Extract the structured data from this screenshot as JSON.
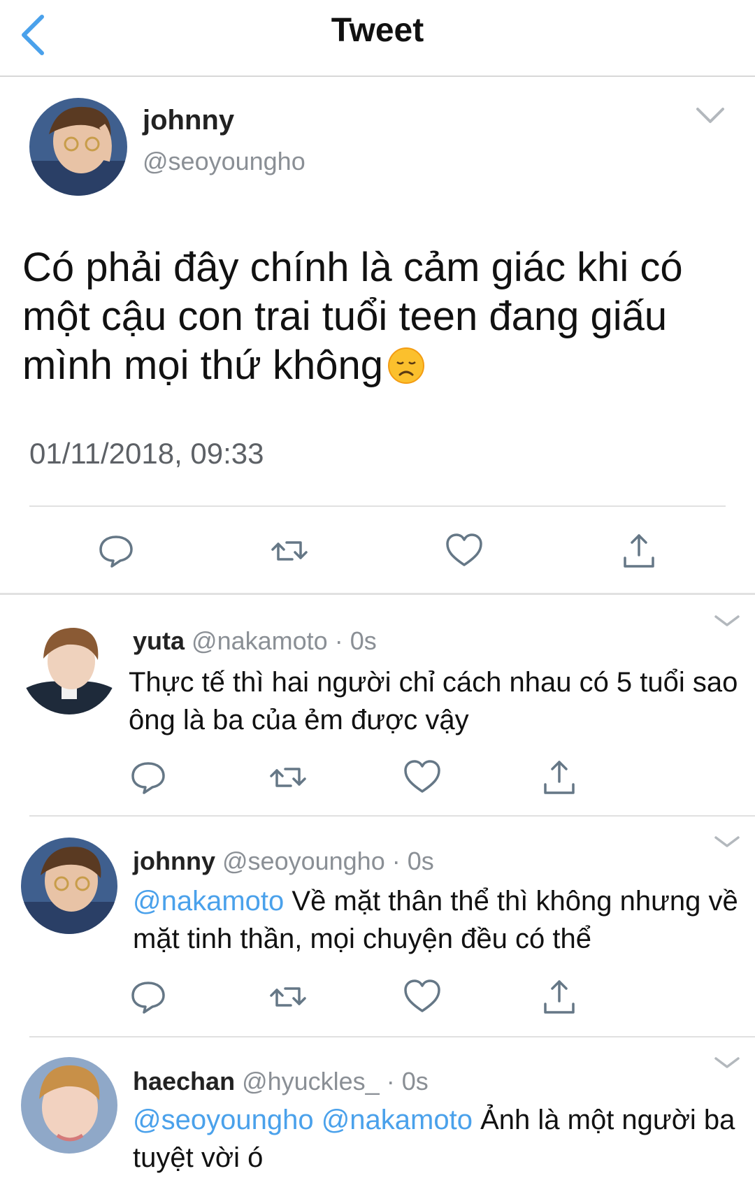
{
  "header": {
    "title": "Tweet"
  },
  "tweet": {
    "author": {
      "name": "johnny",
      "handle": "@seoyoungho"
    },
    "text": "Có phải đây chính là cảm giác khi có một cậu con trai tuổi teen đang giấu mình mọi thứ không",
    "emoji": "disappointed-face",
    "timestamp": "01/11/2018, 09:33"
  },
  "replies": [
    {
      "name": "yuta",
      "handle": "@nakamoto",
      "time": "· 0s",
      "mentions": "",
      "text": "Thực tế thì hai người chỉ cách nhau có 5 tuổi sao ông là ba của ẻm được vậy"
    },
    {
      "name": "johnny",
      "handle": "@seoyoungho",
      "time": "· 0s",
      "mentions": "@nakamoto",
      "text": "Về mặt thân thể thì không nhưng về mặt tinh thần, mọi chuyện đều có thể"
    },
    {
      "name": "haechan",
      "handle": "@hyuckles_",
      "time": "· 0s",
      "mentions": "@seoyoungho @nakamoto",
      "text": "Ảnh là một người ba tuyệt vời ó"
    }
  ],
  "colors": {
    "accent": "#4aa1eb",
    "icon": "#657786",
    "divider": "#e1e1e1",
    "muted": "#8a8f95"
  },
  "icons": [
    "back-chevron-icon",
    "chevron-down-icon",
    "reply-icon",
    "retweet-icon",
    "like-icon",
    "share-icon"
  ]
}
